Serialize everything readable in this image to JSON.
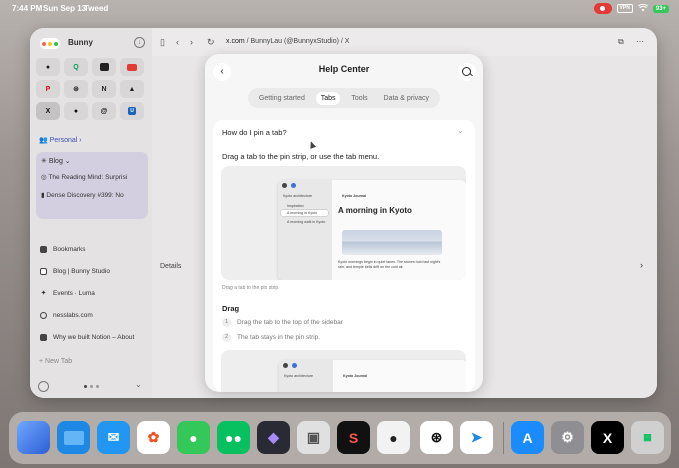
{
  "status_bar": {
    "time": "7:44 PM",
    "date": "Sun Sep 13",
    "app_name": "Tweed",
    "vpn": "VPN",
    "battery": "93+"
  },
  "sidebar": {
    "space_name": "Bunny",
    "profile_label": "Personal",
    "folder": {
      "name": "Blog",
      "items": [
        {
          "label": "The Reading Mind: Surprisi"
        },
        {
          "label": "Dense Discovery #399: No"
        }
      ]
    },
    "tabs": [
      {
        "label": "Bookmarks"
      },
      {
        "label": "Blog | Bunny Studio"
      },
      {
        "label": "Events · Luma"
      },
      {
        "label": "nesslabs.com"
      },
      {
        "label": "Why we built Notion – About"
      }
    ],
    "new_tab_label": "New Tab"
  },
  "browser": {
    "url_domain": "x.com",
    "url_rest": " / BunnyLau (@BunnyxStudio) / X",
    "details_label": "Details"
  },
  "help_center": {
    "title": "Help Center",
    "tabs": [
      {
        "label": "Getting started",
        "active": false
      },
      {
        "label": "Tabs",
        "active": true
      },
      {
        "label": "Tools",
        "active": false
      },
      {
        "label": "Data & privacy",
        "active": false
      }
    ],
    "question": "How do I pin a tab?",
    "intro": "Drag a tab to the pin strip, or use the tab menu.",
    "caption": "Drag a tab to the pin strip",
    "section_heading": "Drag",
    "steps": [
      {
        "num": "1",
        "text": "Drag the tab to the top of the sidebar"
      },
      {
        "num": "2",
        "text": "The tab stays in the pin strip."
      }
    ],
    "illustration": {
      "sidebar_items": [
        "Kyoto architecture",
        "Inspiration",
        "A morning in Kyoto",
        "A morning walk in Kyoto"
      ],
      "doc_header": "Kyoto Journal",
      "article_title": "A morning in Kyoto",
      "article_body": "Kyoto mornings begin in quiet lanes. The stones hold last night's rain, and temple bells drift on the cold air."
    },
    "illustration2": {
      "sidebar_item": "Kyoto architecture",
      "doc_header": "Kyoto Journal"
    }
  },
  "dock": {
    "apps": [
      {
        "name": "Arc",
        "icon": "arc-icon",
        "color": "#3b6fd8"
      },
      {
        "name": "Files",
        "icon": "files-icon",
        "color": "#1e88e5"
      },
      {
        "name": "Mail",
        "icon": "mail-icon",
        "color": "#2196f3"
      },
      {
        "name": "Photos",
        "icon": "photos-icon",
        "color": "#ffffff"
      },
      {
        "name": "Messages",
        "icon": "messages-icon",
        "color": "#34c759"
      },
      {
        "name": "WeChat",
        "icon": "wechat-icon",
        "color": "#07c160"
      },
      {
        "name": "Obsidian",
        "icon": "obsidian-icon",
        "color": "#2a2a35"
      },
      {
        "name": "Screens",
        "icon": "screens-icon",
        "color": "#e0e0e0"
      },
      {
        "name": "Craft",
        "icon": "craft-icon",
        "color": "#111111"
      },
      {
        "name": "Bear",
        "icon": "bear-icon",
        "color": "#2b2b2b"
      },
      {
        "name": "ChatGPT",
        "icon": "chatgpt-icon",
        "color": "#ffffff"
      },
      {
        "name": "Spark",
        "icon": "spark-icon",
        "color": "#ffffff"
      },
      {
        "name": "App Store",
        "icon": "app-store-icon",
        "color": "#1a8cff"
      },
      {
        "name": "Settings",
        "icon": "settings-icon",
        "color": "#8e8e93"
      },
      {
        "name": "X",
        "icon": "x-icon",
        "color": "#000000"
      },
      {
        "name": "Folder",
        "icon": "app-folder-icon",
        "color": "#d0d0d0"
      }
    ]
  }
}
